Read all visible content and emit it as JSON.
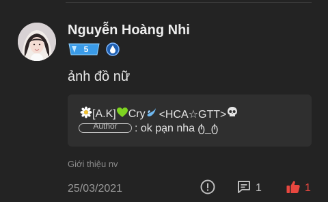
{
  "author": {
    "name": "Nguyễn Hoàng Nhi",
    "level": "5",
    "level_badge_color": "#3a9be8",
    "role_badge_icon": "water-drop-badge-icon",
    "avatar_icon": "user-avatar-photo"
  },
  "post": {
    "content": "ảnh đồ nữ",
    "category": "Giới thiệu nv",
    "date": "25/03/2021"
  },
  "quote": {
    "leading_icon": "daisy-flower-icon",
    "prefix": "[A.K]",
    "heart_icon": "green-heart-icon",
    "name_part": "Cry",
    "droplet_icon": "droplet-icon",
    "suffix": "<HCA☆GTT>",
    "trailing_icon": "skull-icon",
    "author_tag": "Author",
    "message": ": ok pạn nha ტ_ტ"
  },
  "actions": {
    "report_icon": "report-exclamation-icon",
    "comment_count": "1",
    "comment_icon": "comment-icon",
    "like_count": "1",
    "like_icon": "thumbs-up-icon",
    "like_color": "#e8473f",
    "icon_color": "#bdbdbd"
  }
}
